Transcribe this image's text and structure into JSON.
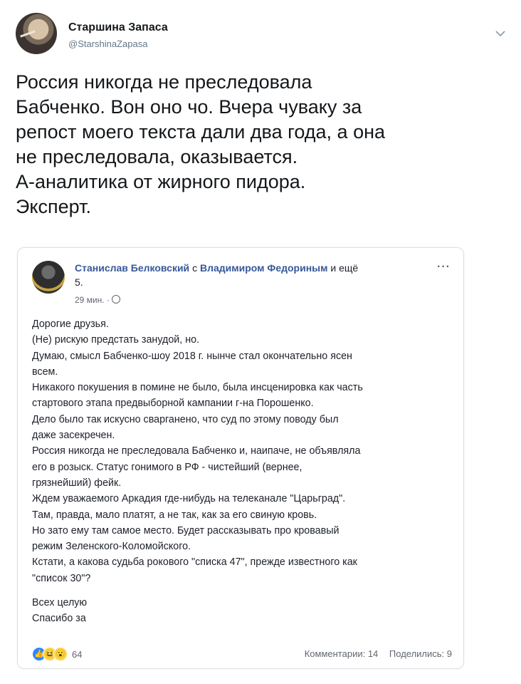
{
  "tweet": {
    "display_name": "Старшина Запаса",
    "handle": "@StarshinaZapasa",
    "text_lines": [
      "Россия никогда не преследовала",
      "Бабченко. Вон оно чо. Вчера чуваку за",
      "репост моего текста дали два года, а она",
      "не преследовала, оказывается.",
      "А-аналитика от жирного пидора.",
      "Эксперт."
    ]
  },
  "icons": {
    "avatar": "user-photo",
    "menu": "chevron-down-icon",
    "fb_menu": "more-dots-icon",
    "privacy": "globe-icon",
    "reactions": [
      "like-icon",
      "haha-icon",
      "wow-icon"
    ]
  },
  "colors": {
    "fb_link": "#365899",
    "tweet_text": "#14171a",
    "secondary": "#657786",
    "fb_border": "#dddfe2"
  },
  "fb_post": {
    "author": "Станислав Белковский",
    "with_prefix": "с",
    "tagged": "Владимиром Федориным",
    "and_more": "и ещё",
    "more_count": "5.",
    "dots": "···",
    "time": "29 мин. ·",
    "body_lines": [
      "Дорогие друзья.",
      "(Не) рискую предстать занудой, но.",
      "Думаю, смысл Бабченко-шоу 2018 г. нынче стал окончательно ясен",
      "всем.",
      "Никакого покушения в помине не было, была инсценировка как часть",
      "стартового этапа предвыборной кампании г-на Порошенко.",
      "Дело было так искусно сварганено, что суд по этому поводу был",
      "даже засекречен.",
      "Россия никогда не преследовала Бабченко и, наипаче, не объявляла",
      "его в розыск. Статус гонимого в РФ - чистейший (вернее,",
      "грязнейший) фейк.",
      "Ждем уважаемого Аркадия где-нибудь на телеканале \"Царьград\".",
      "Там, правда, мало платят, а не так, как за его свиную кровь.",
      "Но зато ему там самое место. Будет рассказывать про кровавый",
      "режим Зеленского-Коломойского.",
      "Кстати, а какова судьба рокового \"списка 47\", прежде известного как",
      "\"список 30\"?"
    ],
    "closing_lines": [
      "Всех целую",
      "Спасибо за"
    ],
    "reaction_count": "64",
    "comments": "Комментарии: 14",
    "shares": "Поделились: 9"
  }
}
